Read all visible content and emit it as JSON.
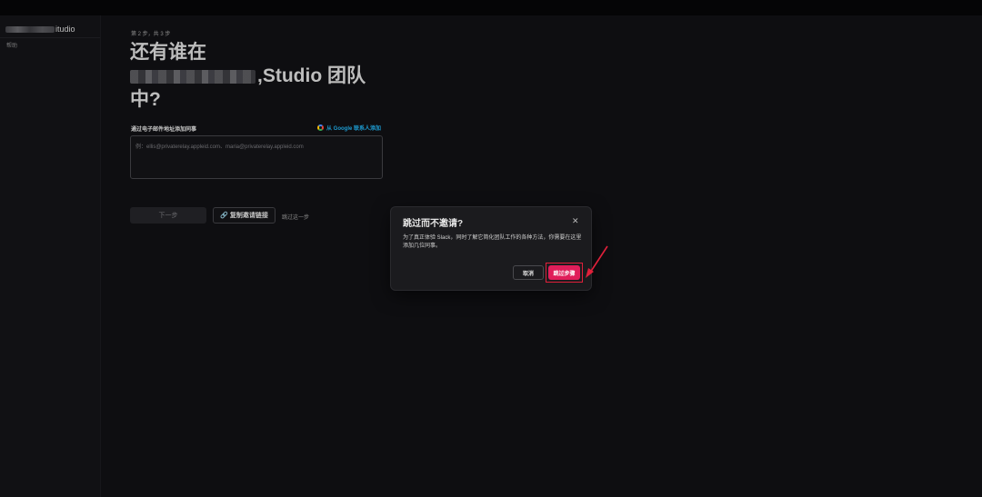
{
  "sidebar": {
    "workspace_name_suffix": "itudio",
    "help_label": "帮助"
  },
  "main": {
    "step_label": "第 2 步，共 3 步",
    "title_line1": "还有谁在",
    "title_line2_suffix": ",Studio 团队",
    "title_line3": "中?",
    "email_label": "通过电子邮件地址添加同事",
    "google_link": "从 Google 联系人添加",
    "email_placeholder": "例：ellis@privaterelay.appleid.com、maria@privaterelay.appleid.com",
    "next_button": "下一步",
    "copy_link_button": "复制邀请链接",
    "skip_link": "跳过这一步"
  },
  "modal": {
    "title": "跳过而不邀请?",
    "body": "为了真正体验 Slack，同时了解它简化团队工作的各种方法，你需要在这里添加几位同事。",
    "cancel_button": "取消",
    "skip_button": "跳过步骤"
  },
  "colors": {
    "accent_red": "#e01e5a",
    "annotation_red": "#e0203a",
    "link_blue": "#1d9bd1"
  },
  "icons": [
    "google-icon",
    "link-icon",
    "close-icon",
    "annotation-arrow-icon"
  ]
}
